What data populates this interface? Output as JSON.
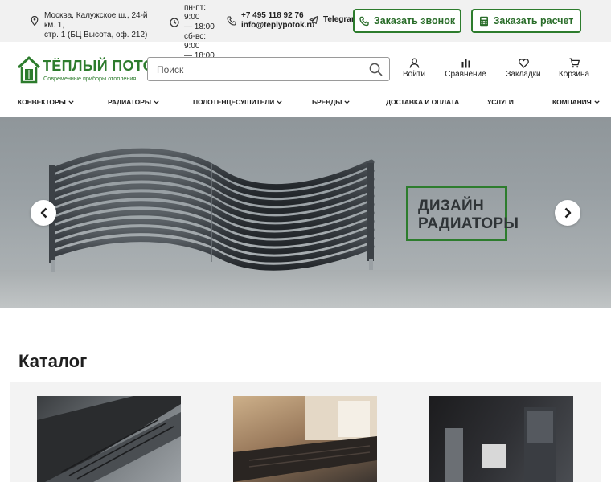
{
  "topbar": {
    "address_line1": "Москва, Калужское ш., 24-й км. 1,",
    "address_line2": "стр. 1 (БЦ Высота, оф. 212)",
    "hours_line1": "пн-пт: 9:00",
    "hours_line2": "— 18:00",
    "hours_line3": "сб-вс: 9:00",
    "hours_line4": "— 18:00",
    "phone": "+7 495 118 92 76",
    "email": "info@teplypotok.ru",
    "telegram": "Telegram",
    "call_button": "Заказать звонок",
    "calc_button": "Заказать расчет"
  },
  "logo": {
    "name": "ТЁПЛЫЙ ПОТОК",
    "tagline": "Современные приборы отопления"
  },
  "search": {
    "placeholder": "Поиск",
    "value": ""
  },
  "header_icons": {
    "login": "Войти",
    "compare": "Сравнение",
    "bookmarks": "Закладки",
    "cart": "Корзина"
  },
  "nav": {
    "items": [
      {
        "label": "КОНВЕКТОРЫ",
        "has_dropdown": true
      },
      {
        "label": "РАДИАТОРЫ",
        "has_dropdown": true
      },
      {
        "label": "ПОЛОТЕНЦЕСУШИТЕЛИ",
        "has_dropdown": true
      },
      {
        "label": "БРЕНДЫ",
        "has_dropdown": true
      },
      {
        "label": "ДОСТАВКА И ОПЛАТА",
        "has_dropdown": false
      },
      {
        "label": "УСЛУГИ",
        "has_dropdown": false
      },
      {
        "label": "КОМПАНИЯ",
        "has_dropdown": true
      }
    ]
  },
  "hero": {
    "line1": "ДИЗАЙН",
    "line2": "РАДИАТОРЫ"
  },
  "catalog": {
    "title": "Каталог"
  },
  "colors": {
    "brand_green": "#2d7c2d",
    "topbar_bg": "#f1f1f1"
  }
}
